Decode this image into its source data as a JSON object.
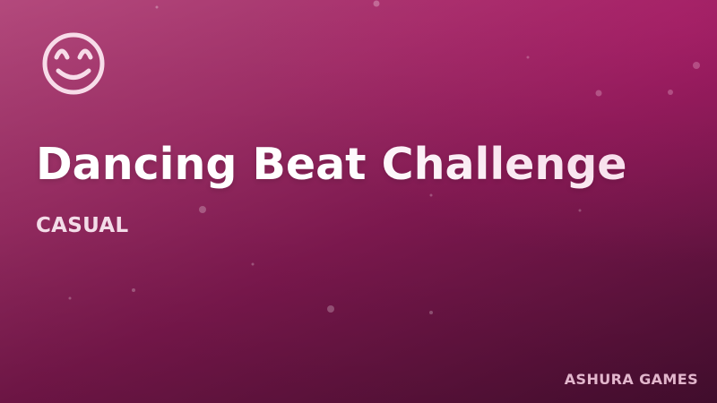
{
  "game": {
    "title": "Dancing Beat Challenge",
    "genre": "CASUAL",
    "publisher": "ASHURA GAMES",
    "icon": "smiling-face-icon"
  },
  "colors": {
    "background_start": "#b3497c",
    "background_end": "#521038",
    "title_text": "#ffffff",
    "genre_text": "#f3dce8",
    "publisher_text": "#e2b6cc",
    "icon_stroke": "#f7dce9"
  }
}
